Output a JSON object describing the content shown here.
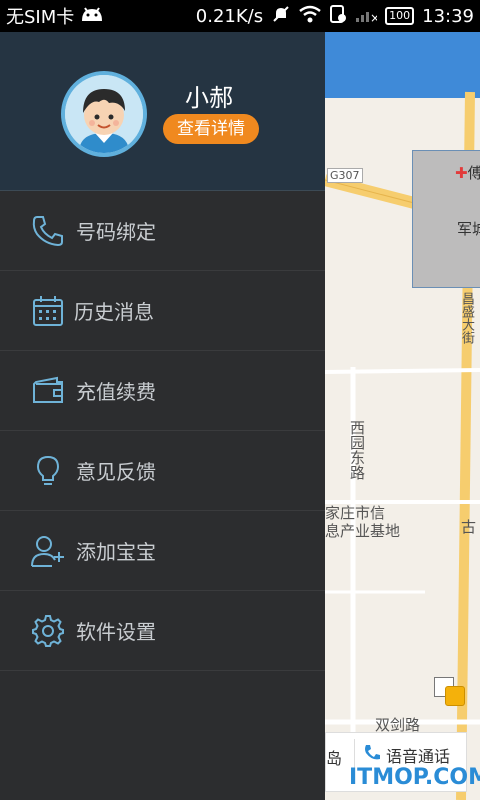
{
  "status_bar": {
    "carrier": "无SIM卡",
    "speed": "0.21K/s",
    "battery": "100",
    "time": "13:39"
  },
  "drawer": {
    "user_name": "小郝",
    "detail_button": "查看详情",
    "menu": [
      {
        "label": "号码绑定",
        "icon": "phone-icon"
      },
      {
        "label": "历史消息",
        "icon": "calendar-icon"
      },
      {
        "label": "充值续费",
        "icon": "wallet-icon"
      },
      {
        "label": "意见反馈",
        "icon": "lightbulb-icon"
      },
      {
        "label": "添加宝宝",
        "icon": "add-person-icon"
      },
      {
        "label": "软件设置",
        "icon": "gear-icon"
      }
    ]
  },
  "map": {
    "road_g307": "G307",
    "poi_1": "傅山",
    "poi_2": "军城",
    "street_vertical": "昌盛大街",
    "street_west": "西园东路",
    "poi_3": "家庄市信",
    "poi_3b": "息产业基地",
    "poi_4": "古",
    "street_bottom": "双剑路",
    "bottom_left": "岛",
    "voice_call": "语音通话",
    "watermark": "ITMOP.COM"
  },
  "colors": {
    "drawer_bg": "#2c2d2f",
    "profile_bg": "#253442",
    "accent_orange": "#f0891f",
    "map_top_blue": "#3f8ad8",
    "icon_blue": "#6fb3d8"
  }
}
